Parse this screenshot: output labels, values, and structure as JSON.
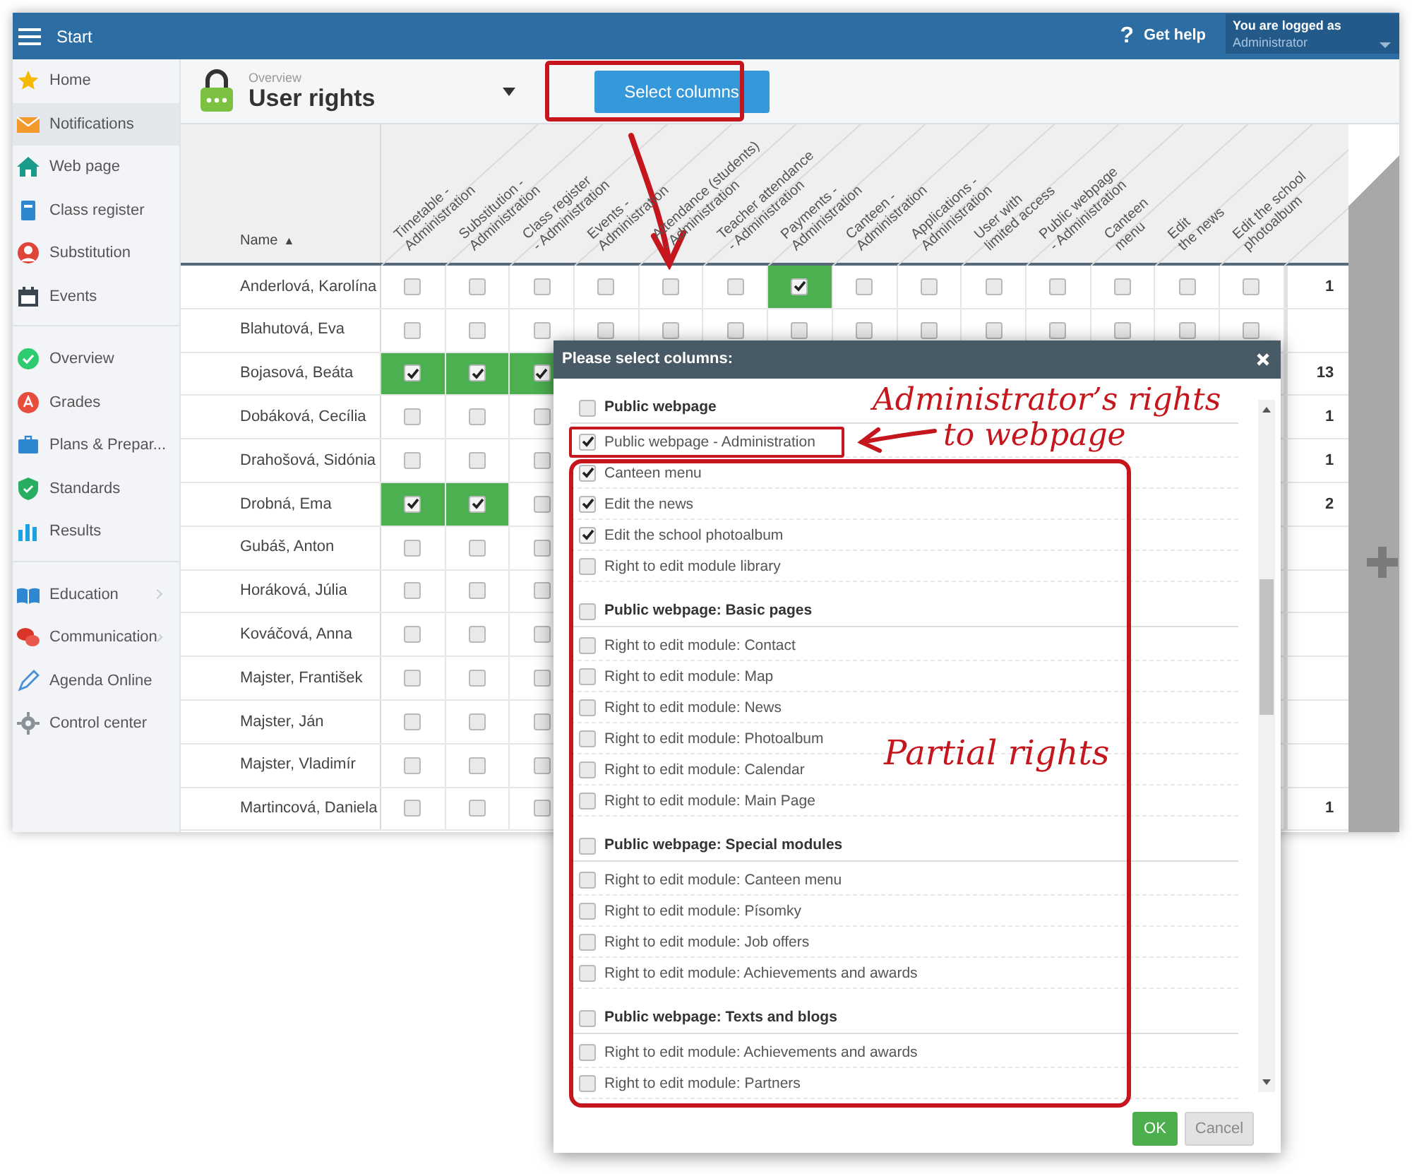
{
  "header": {
    "title": "Start",
    "help_icon": "?",
    "help": "Get help",
    "login_caption": "You are logged as",
    "login_user": "Administrator"
  },
  "sidebar": {
    "sections": [
      [
        {
          "label": "Home",
          "selected": false,
          "submenu": false
        },
        {
          "label": "Notifications",
          "selected": true,
          "submenu": false
        },
        {
          "label": "Web page",
          "selected": false,
          "submenu": false
        },
        {
          "label": "Class register",
          "selected": false,
          "submenu": false
        },
        {
          "label": "Substitution",
          "selected": false,
          "submenu": false
        },
        {
          "label": "Events",
          "selected": false,
          "submenu": false
        }
      ],
      [
        {
          "label": "Overview",
          "selected": false,
          "submenu": false
        },
        {
          "label": "Grades",
          "selected": false,
          "submenu": false
        },
        {
          "label": "Plans & Prepar...",
          "selected": false,
          "submenu": false
        },
        {
          "label": "Standards",
          "selected": false,
          "submenu": false
        },
        {
          "label": "Results",
          "selected": false,
          "submenu": false
        }
      ],
      [
        {
          "label": "Education",
          "selected": false,
          "submenu": true
        },
        {
          "label": "Communication",
          "selected": false,
          "submenu": true
        },
        {
          "label": "Agenda Online",
          "selected": false,
          "submenu": false
        },
        {
          "label": "Control center",
          "selected": false,
          "submenu": false
        }
      ]
    ]
  },
  "toolbar": {
    "caption": "Overview",
    "title": "User rights",
    "select_button": "Select columns"
  },
  "table": {
    "name_header": "Name",
    "sort_mark": "▲",
    "columns": [
      "Timetable -\nAdministration",
      "Substitution -\nAdministration",
      "Class register\n- Administration",
      "Events -\nAdministration",
      "Attendance (students)\n- Administration",
      "Teacher attendance\n- Administration",
      "Payments -\nAdministration",
      "Canteen -\nAdministration",
      "Applications -\nAdministration",
      "User with\nlimited access",
      "Public webpage\n- Administration",
      "Canteen\nmenu",
      "Edit\nthe news",
      "Edit the school\nphotoalbum"
    ],
    "rows": [
      {
        "name": "Anderlová, Karolína",
        "count": "1",
        "cells": [
          {
            "checked": false
          },
          {
            "checked": false
          },
          {
            "checked": false
          },
          {
            "checked": false
          },
          {
            "checked": false
          },
          {
            "checked": false
          },
          {
            "checked": true
          },
          {
            "checked": false
          },
          {
            "checked": false
          },
          {
            "checked": false
          },
          {
            "checked": false
          },
          {
            "checked": false
          },
          {
            "checked": false
          },
          {
            "checked": false
          }
        ]
      },
      {
        "name": "Blahutová, Eva",
        "cells": [
          {
            "checked": false
          },
          {
            "checked": false
          },
          {
            "checked": false
          },
          {
            "checked": false
          },
          {
            "checked": false
          },
          {
            "checked": false
          },
          {
            "checked": false
          },
          {
            "checked": false
          },
          {
            "checked": false
          },
          {
            "checked": false
          },
          {
            "checked": false
          },
          {
            "checked": false
          },
          {
            "checked": false
          },
          {
            "checked": false
          }
        ]
      },
      {
        "name": "Bojasová, Beáta",
        "count": "13",
        "cells": [
          {
            "checked": true
          },
          {
            "checked": true
          },
          {
            "checked": true
          }
        ]
      },
      {
        "name": "Dobáková, Cecília",
        "count": "1",
        "cells": [
          {
            "checked": false
          },
          {
            "checked": false
          },
          {
            "checked": false
          }
        ]
      },
      {
        "name": "Drahošová, Sidónia",
        "count": "1",
        "cells": [
          {
            "checked": false
          },
          {
            "checked": false
          },
          {
            "checked": false
          }
        ]
      },
      {
        "name": "Drobná, Ema",
        "count": "2",
        "cells": [
          {
            "checked": true
          },
          {
            "checked": true
          },
          {
            "checked": false
          }
        ]
      },
      {
        "name": "Gubáš, Anton",
        "cells": [
          {
            "checked": false
          },
          {
            "checked": false
          },
          {
            "checked": false
          }
        ]
      },
      {
        "name": "Horáková, Júlia",
        "cells": [
          {
            "checked": false
          },
          {
            "checked": false
          },
          {
            "checked": false
          }
        ]
      },
      {
        "name": "Kováčová, Anna",
        "cells": [
          {
            "checked": false
          },
          {
            "checked": false
          },
          {
            "checked": false
          }
        ]
      },
      {
        "name": "Majster, František",
        "cells": [
          {
            "checked": false
          },
          {
            "checked": false
          },
          {
            "checked": false
          }
        ]
      },
      {
        "name": "Majster, Ján",
        "cells": [
          {
            "checked": false
          },
          {
            "checked": false
          },
          {
            "checked": false
          }
        ]
      },
      {
        "name": "Majster, Vladimír",
        "cells": [
          {
            "checked": false
          },
          {
            "checked": false
          },
          {
            "checked": false
          }
        ]
      },
      {
        "name": "Martincová, Daniela",
        "count": "1",
        "cells": [
          {
            "checked": false
          },
          {
            "checked": false
          },
          {
            "checked": false
          }
        ]
      }
    ]
  },
  "dialog": {
    "title": "Please select columns:",
    "groups": [
      {
        "title": "Public webpage",
        "checked": false,
        "items": [
          {
            "label": "Public webpage - Administration",
            "checked": true
          },
          {
            "label": "Canteen menu",
            "checked": true
          },
          {
            "label": "Edit the news",
            "checked": true
          },
          {
            "label": "Edit the school photoalbum",
            "checked": true
          },
          {
            "label": "Right to edit module library",
            "checked": false
          }
        ]
      },
      {
        "title": "Public webpage: Basic pages",
        "checked": false,
        "items": [
          {
            "label": "Right to edit module: Contact",
            "checked": false
          },
          {
            "label": "Right to edit module: Map",
            "checked": false
          },
          {
            "label": "Right to edit module: News",
            "checked": false
          },
          {
            "label": "Right to edit module: Photoalbum",
            "checked": false
          },
          {
            "label": "Right to edit module: Calendar",
            "checked": false
          },
          {
            "label": "Right to edit module: Main Page",
            "checked": false
          }
        ]
      },
      {
        "title": "Public webpage: Special modules",
        "checked": false,
        "items": [
          {
            "label": "Right to edit module: Canteen menu",
            "checked": false
          },
          {
            "label": "Right to edit module: Písomky",
            "checked": false
          },
          {
            "label": "Right to edit module: Job offers",
            "checked": false
          },
          {
            "label": "Right to edit module: Achievements and awards",
            "checked": false
          }
        ]
      },
      {
        "title": "Public webpage: Texts and blogs",
        "checked": false,
        "items": [
          {
            "label": "Right to edit module: Achievements and awards",
            "checked": false
          },
          {
            "label": "Right to edit module: Partners",
            "checked": false
          }
        ]
      }
    ],
    "ok": "OK",
    "cancel": "Cancel"
  },
  "annotations": [
    {
      "kind": "callout",
      "text": "Administrator’s rights"
    },
    {
      "kind": "callout",
      "text": "to webpage"
    },
    {
      "kind": "callout",
      "text": "Partial rights"
    }
  ]
}
